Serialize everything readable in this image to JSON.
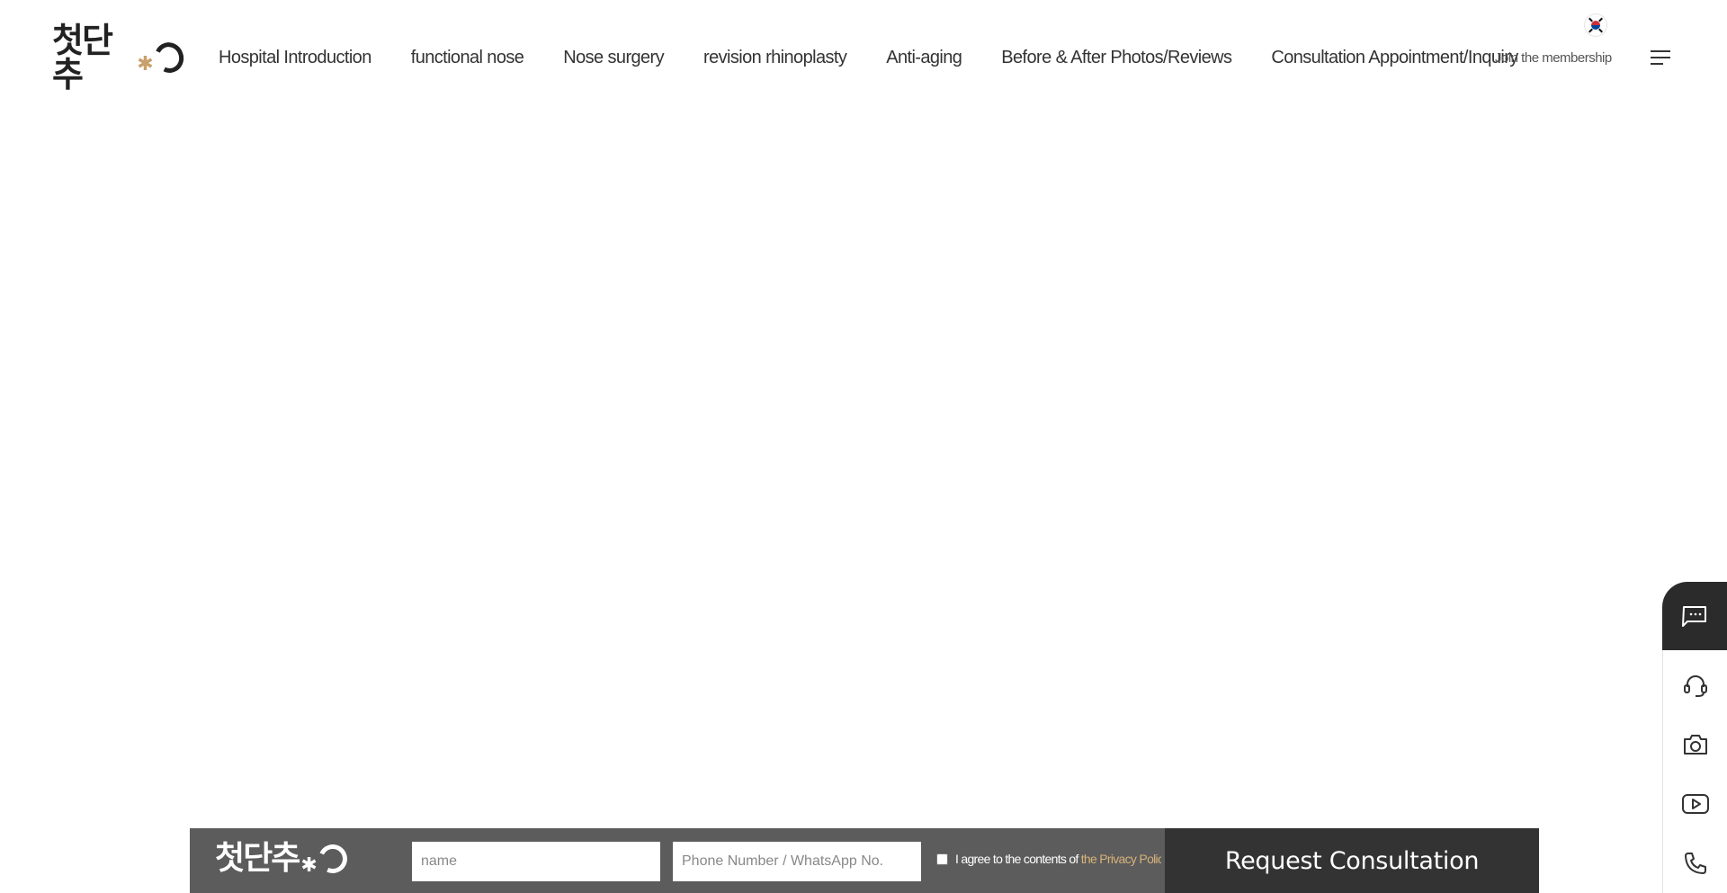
{
  "header": {
    "logo_text": "첫단추",
    "nav": [
      {
        "label": "Hospital Introduction"
      },
      {
        "label": "functional nose"
      },
      {
        "label": "Nose surgery"
      },
      {
        "label": "revision rhinoplasty"
      },
      {
        "label": "Anti-aging"
      },
      {
        "label": "Before & After Photos/Reviews"
      },
      {
        "label": "Consultation Appointment/Inquiry"
      }
    ],
    "membership_label": "Join the membership",
    "language_icon": "korea-flag-icon",
    "menu_icon": "hamburger-menu-icon"
  },
  "quick_bar": {
    "items": [
      {
        "icon": "chat-bubble-icon"
      },
      {
        "icon": "headset-icon"
      },
      {
        "icon": "camera-icon"
      },
      {
        "icon": "youtube-icon"
      },
      {
        "icon": "phone-icon"
      }
    ]
  },
  "consult_form": {
    "logo_text": "첫단추",
    "name_placeholder": "name",
    "phone_placeholder": "Phone Number / WhatsApp No.",
    "agree_text": "I agree to the contents of",
    "agree_link": "the Privacy Policy",
    "submit_label": "Request Consultation"
  },
  "colors": {
    "accent": "#c8a06b",
    "consult_bar_bg": "#5c5c5c",
    "submit_bg": "#333333",
    "quick_chat_bg": "#2b2b2b",
    "link": "#d7b27a"
  }
}
